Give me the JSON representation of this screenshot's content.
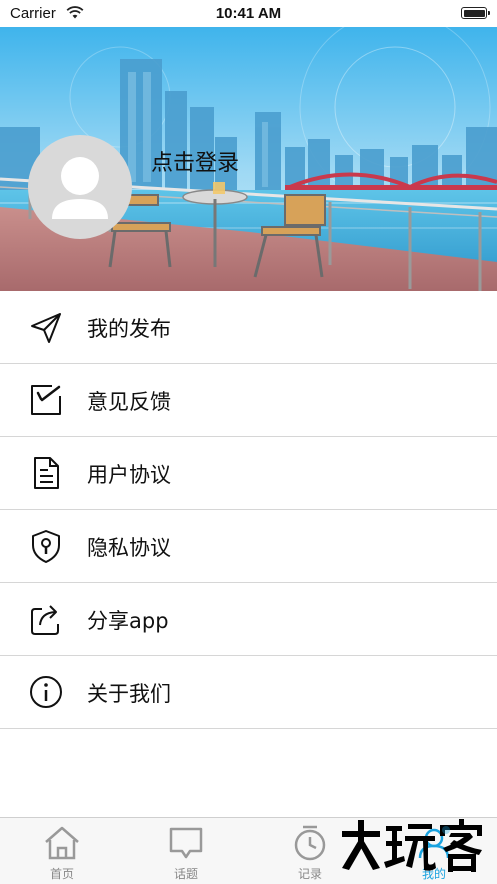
{
  "status_bar": {
    "carrier": "Carrier",
    "time": "10:41 AM"
  },
  "header": {
    "login_text": "点击登录"
  },
  "menu": {
    "items": [
      {
        "label": "我的发布",
        "icon": "send-icon"
      },
      {
        "label": "意见反馈",
        "icon": "feedback-edit-icon"
      },
      {
        "label": "用户协议",
        "icon": "document-icon"
      },
      {
        "label": "隐私协议",
        "icon": "shield-lock-icon"
      },
      {
        "label": "分享app",
        "icon": "share-icon"
      },
      {
        "label": "关于我们",
        "icon": "info-icon"
      }
    ]
  },
  "tabbar": {
    "tabs": [
      {
        "label": "首页",
        "icon": "home-icon",
        "active": false
      },
      {
        "label": "话题",
        "icon": "chat-bubble-icon",
        "active": false
      },
      {
        "label": "记录",
        "icon": "clock-icon",
        "active": false
      },
      {
        "label": "我的",
        "icon": "profile-icon",
        "active": true
      }
    ],
    "active_color": "#1aa3e0",
    "inactive_color": "#888888"
  },
  "watermark": {
    "text": "大玩客"
  }
}
